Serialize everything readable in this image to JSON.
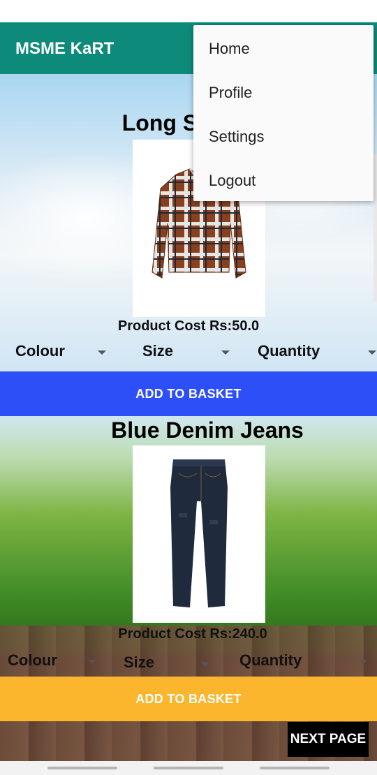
{
  "app": {
    "title": "MSME KaRT"
  },
  "menu": {
    "items": [
      {
        "label": "Home"
      },
      {
        "label": "Profile"
      },
      {
        "label": "Settings"
      },
      {
        "label": "Logout"
      }
    ]
  },
  "products": [
    {
      "title": "Long Sleeve",
      "image_icon": "plaid-shirt-image",
      "cost": "Product Cost Rs:50.0",
      "colour_label": "Colour",
      "size_label": "Size",
      "quantity_label": "Quantity",
      "button_label": "ADD TO BASKET",
      "button_color": "#2d4ff8"
    },
    {
      "title": "Blue Denim Jeans",
      "image_icon": "denim-jeans-image",
      "cost": "Product Cost Rs:240.0",
      "colour_label": "Colour",
      "size_label": "Size",
      "quantity_label": "Quantity",
      "button_label": "ADD TO BASKET",
      "button_color": "#fbb62d"
    }
  ],
  "footer": {
    "next_label": "NEXT PAGE"
  },
  "colors": {
    "app_bar": "#0d8a7a"
  }
}
